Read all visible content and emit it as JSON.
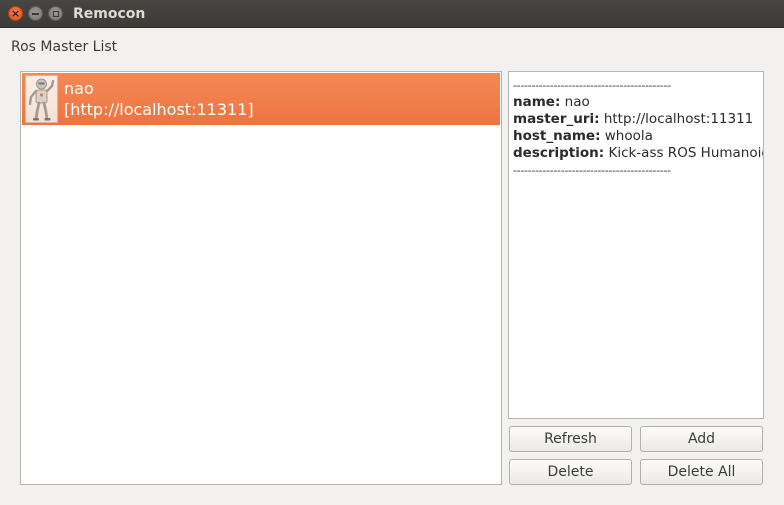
{
  "window": {
    "title": "Remocon",
    "controls": {
      "close_icon": "close-icon",
      "minimize_icon": "minimize-icon",
      "maximize_icon": "maximize-icon"
    }
  },
  "section_label": "Ros Master List",
  "masters": [
    {
      "name": "nao",
      "uri": "[http://localhost:11311]",
      "icon": "robot-icon",
      "selected": true
    }
  ],
  "info": {
    "separator": "-------------------------------------------",
    "fields": [
      {
        "key": "name:",
        "value": " nao"
      },
      {
        "key": "master_uri:",
        "value": " http://localhost:11311"
      },
      {
        "key": "host_name:",
        "value": " whoola"
      },
      {
        "key": "description:",
        "value": " Kick-ass ROS Humanoid"
      }
    ]
  },
  "buttons": {
    "refresh": "Refresh",
    "add": "Add",
    "delete": "Delete",
    "delete_all": "Delete All"
  },
  "colors": {
    "selection": "#ef7745",
    "titlebar": "#3c3b37",
    "window_bg": "#f2f1f0",
    "close_button": "#df4a16"
  }
}
